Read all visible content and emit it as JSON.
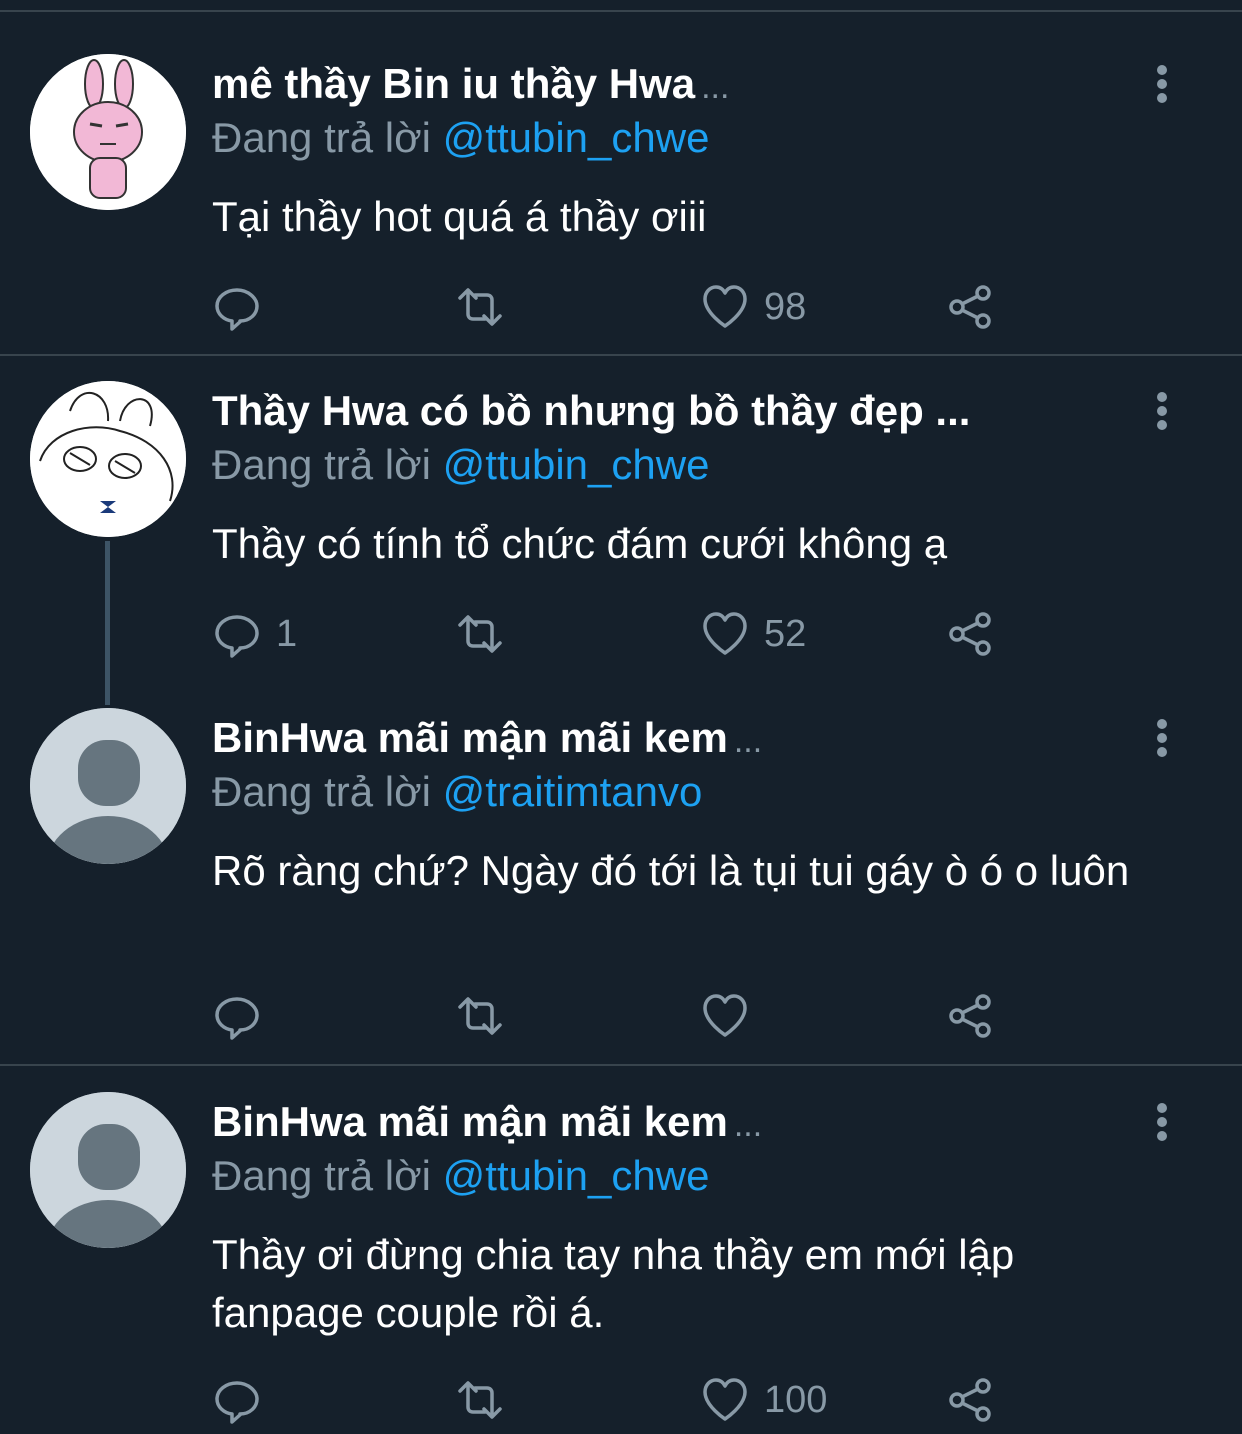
{
  "colors": {
    "background": "#15202b",
    "divider": "#38444d",
    "text_primary": "#ffffff",
    "text_secondary": "#8899a6",
    "link": "#1da1f2"
  },
  "tweets": [
    {
      "avatar": "pink-bunny-avatar",
      "name": "mê thầy Bin iu thầy Hwa",
      "ellipsis": "...",
      "reply_prefix": "Đang trả lời",
      "reply_handle": "@ttubin_chwe",
      "text": "Tại thầy hot quá á thầy ơiii",
      "counts": {
        "reply": "",
        "retweet": "",
        "like": "98"
      }
    },
    {
      "avatar": "sketch-bunny-avatar",
      "name": "Thầy Hwa có bồ nhưng bồ thầy đẹp ...",
      "ellipsis": "",
      "reply_prefix": "Đang trả lời",
      "reply_handle": "@ttubin_chwe",
      "text": "Thầy có tính tổ chức đám cưới không ạ",
      "counts": {
        "reply": "1",
        "retweet": "",
        "like": "52"
      }
    },
    {
      "avatar": "default-avatar",
      "name": "BinHwa mãi mận mãi kem",
      "ellipsis": "...",
      "reply_prefix": "Đang trả lời",
      "reply_handle": "@traitimtanvo",
      "text": "Rõ ràng chứ? Ngày đó tới là tụi tui gáy ò ó o luôn",
      "counts": {
        "reply": "",
        "retweet": "",
        "like": ""
      }
    },
    {
      "avatar": "default-avatar",
      "name": "BinHwa mãi mận mãi kem",
      "ellipsis": "...",
      "reply_prefix": "Đang trả lời",
      "reply_handle": "@ttubin_chwe",
      "text": "Thầy ơi đừng chia tay nha thầy em mới lập fanpage couple rồi á.",
      "counts": {
        "reply": "",
        "retweet": "",
        "like": "100"
      }
    }
  ],
  "icons": {
    "reply": "reply-icon",
    "retweet": "retweet-icon",
    "like": "heart-icon",
    "share": "share-icon",
    "more": "more-vertical-icon"
  }
}
